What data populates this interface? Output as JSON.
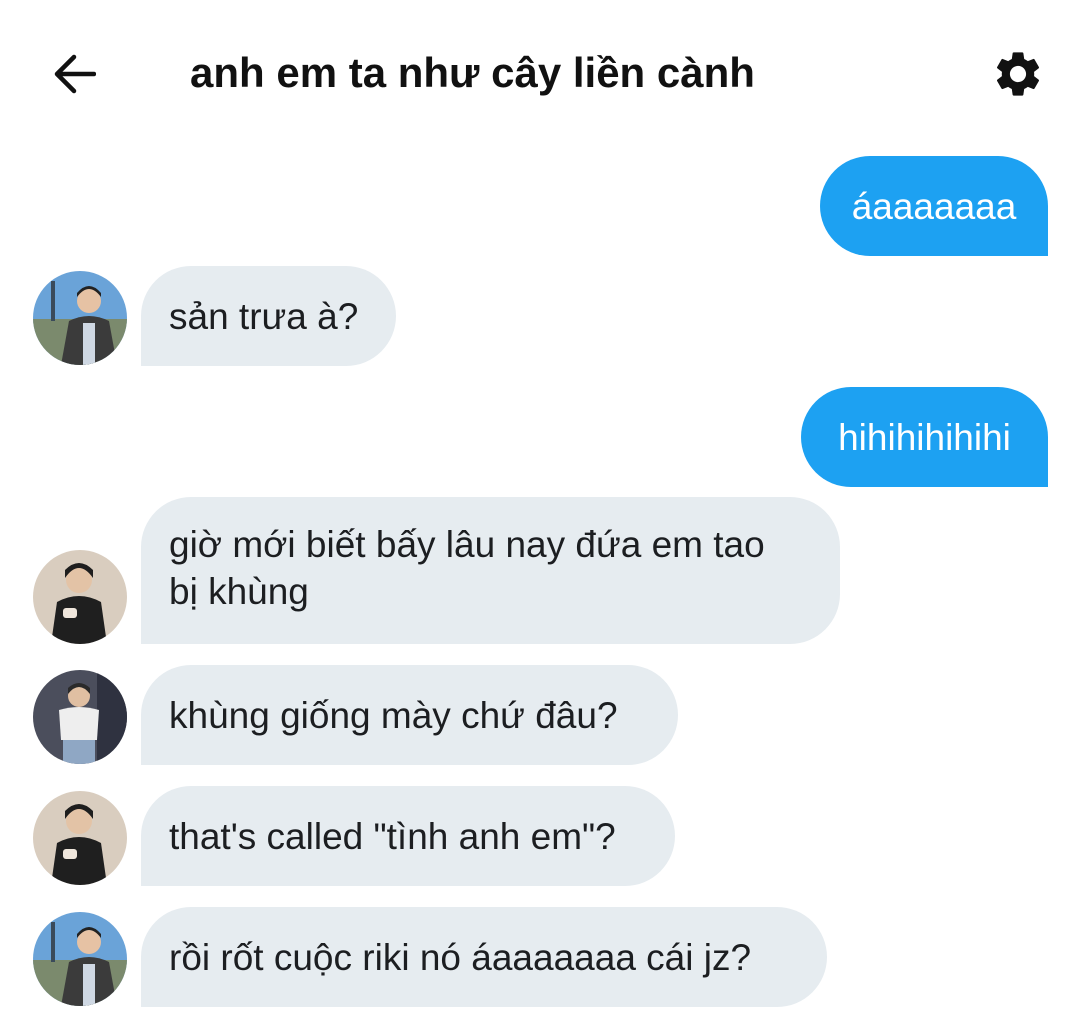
{
  "header": {
    "title": "anh em ta như cây liền cành",
    "back_icon": "arrow-left-icon",
    "settings_icon": "gear-icon"
  },
  "messages": [
    {
      "direction": "out",
      "text": "áaaaaaaa"
    },
    {
      "direction": "in",
      "avatar": "avatar-a",
      "text": "sản trưa à?"
    },
    {
      "direction": "out",
      "text": "hihihihihihi"
    },
    {
      "direction": "in",
      "avatar": "avatar-b",
      "lines": [
        "giờ mới biết bấy lâu nay đứa em tao",
        "bị khùng"
      ]
    },
    {
      "direction": "in",
      "avatar": "avatar-c",
      "text": "khùng giống mày chứ đâu?"
    },
    {
      "direction": "in",
      "avatar": "avatar-b",
      "text": "that's called \"tình anh em\"?"
    },
    {
      "direction": "in",
      "avatar": "avatar-a",
      "text": "rồi rốt cuộc riki nó áaaaaaaa cái jz?"
    }
  ],
  "colors": {
    "outgoing_bubble": "#1da1f2",
    "incoming_bubble": "#e6ecf0"
  }
}
